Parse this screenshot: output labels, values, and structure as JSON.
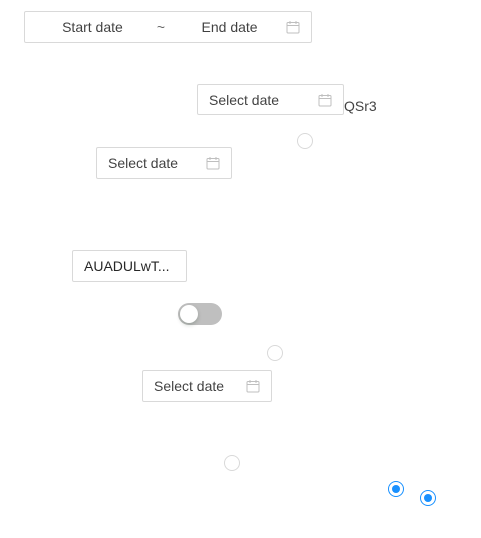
{
  "range_picker": {
    "start_placeholder": "Start date",
    "separator": "~",
    "end_placeholder": "End date",
    "icon": "calendar-icon"
  },
  "date_picker_1": {
    "placeholder": "Select date",
    "icon": "calendar-icon"
  },
  "date_picker_2": {
    "placeholder": "Select date",
    "icon": "calendar-icon"
  },
  "date_picker_3": {
    "placeholder": "Select date",
    "icon": "calendar-icon"
  },
  "text_label": "QSr3",
  "text_input": {
    "value": "AUADULwT..."
  },
  "switch": {
    "checked": false
  },
  "radios": [
    {
      "checked": false
    },
    {
      "checked": false
    },
    {
      "checked": false
    },
    {
      "checked": true
    },
    {
      "checked": true
    }
  ],
  "colors": {
    "primary": "#1890ff",
    "border": "#d9d9d9",
    "switch_off": "#bfbfbf"
  }
}
